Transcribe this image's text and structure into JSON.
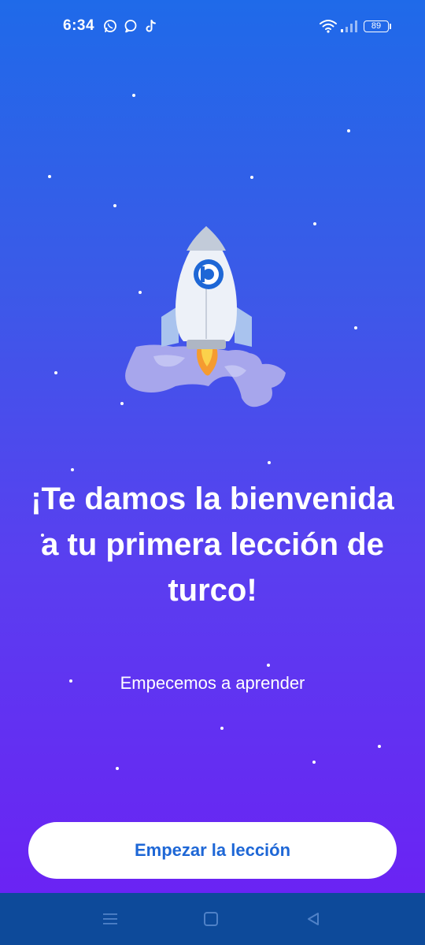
{
  "status_bar": {
    "time": "6:34",
    "battery": "89",
    "app_icons": [
      "whatsapp-icon",
      "chat-bubble-icon",
      "tiktok-icon"
    ],
    "right_icons": [
      "wifi-icon",
      "signal-icon",
      "battery-icon"
    ]
  },
  "welcome": {
    "title": "¡Te damos la bienvenida a tu primera lección de turco!",
    "subtitle": "Empecemos a aprender"
  },
  "actions": {
    "start_label": "Empezar la lección"
  },
  "nav_bar": {
    "items": [
      "menu-icon",
      "home-square-icon",
      "back-triangle-icon"
    ]
  },
  "colors": {
    "gradient_top": "#1f6ae9",
    "gradient_bottom": "#6d1ff4",
    "button_text": "#1e67d6",
    "button_bg": "#ffffff",
    "nav_bar_bg": "#0d4a9a",
    "rocket_logo": "#1e67d6",
    "flame": "#f59b30"
  },
  "illustration": {
    "icon": "rocket-icon"
  }
}
